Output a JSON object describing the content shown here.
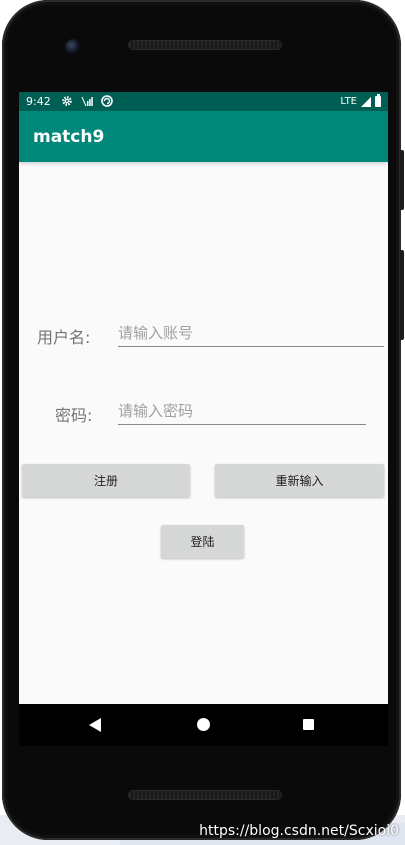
{
  "status_bar": {
    "time": "9:42",
    "icons": [
      "gear-icon",
      "signal-off-icon",
      "sync-icon"
    ],
    "network": "LTE"
  },
  "app_bar": {
    "title": "match9"
  },
  "form": {
    "username_label": "用户名:",
    "username_placeholder": "请输入账号",
    "password_label": "密码:",
    "password_placeholder": "请输入密码"
  },
  "buttons": {
    "register": "注册",
    "reset": "重新输入",
    "login": "登陆"
  },
  "nav_bar": {
    "icons": [
      "back-icon",
      "home-icon",
      "recents-icon"
    ]
  },
  "watermark": "https://blog.csdn.net/Scxioi0",
  "colors": {
    "status_bar": "#005f54",
    "app_bar": "#00897b",
    "button": "#d6d7d7",
    "screen_background": "#fafafa"
  }
}
